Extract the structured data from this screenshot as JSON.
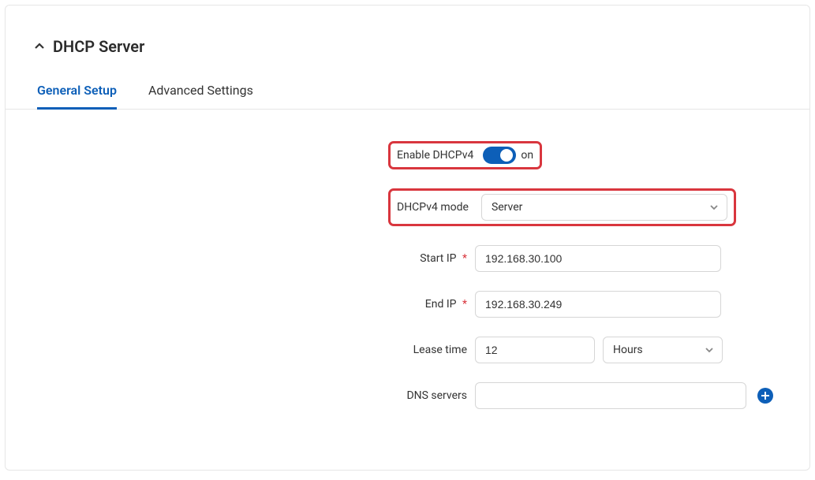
{
  "section": {
    "title": "DHCP Server"
  },
  "tabs": {
    "general": "General Setup",
    "advanced": "Advanced Settings"
  },
  "form": {
    "enable_dhcpv4": {
      "label": "Enable DHCPv4",
      "state": "on"
    },
    "dhcpv4_mode": {
      "label": "DHCPv4 mode",
      "value": "Server"
    },
    "start_ip": {
      "label": "Start IP",
      "value": "192.168.30.100"
    },
    "end_ip": {
      "label": "End IP",
      "value": "192.168.30.249"
    },
    "lease_time": {
      "label": "Lease time",
      "value": "12",
      "unit": "Hours"
    },
    "dns_servers": {
      "label": "DNS servers",
      "value": ""
    }
  }
}
